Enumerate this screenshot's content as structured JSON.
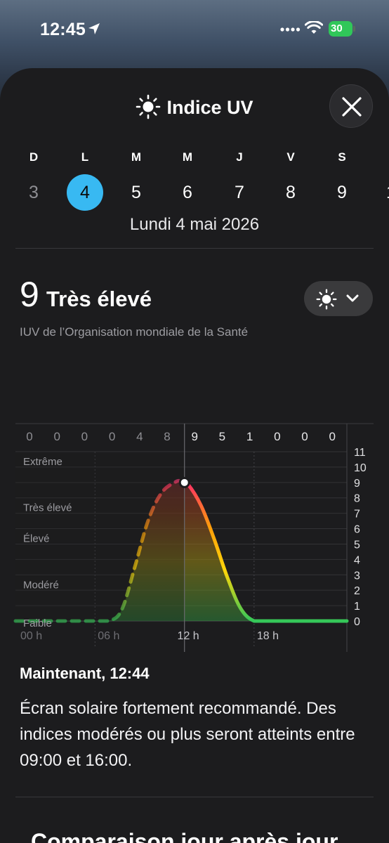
{
  "status_bar": {
    "time": "12:45",
    "battery": "30",
    "battery_color": "#30c759"
  },
  "header": {
    "title": "Indice UV",
    "icon": "sun-icon",
    "close_icon": "close-icon"
  },
  "week": {
    "letters": [
      "D",
      "L",
      "M",
      "M",
      "J",
      "V",
      "S"
    ],
    "days": [
      {
        "num": "3",
        "state": "past"
      },
      {
        "num": "4",
        "state": "selected"
      },
      {
        "num": "5",
        "state": "normal"
      },
      {
        "num": "6",
        "state": "normal"
      },
      {
        "num": "7",
        "state": "normal"
      },
      {
        "num": "8",
        "state": "normal"
      },
      {
        "num": "9",
        "state": "normal"
      },
      {
        "num": "1",
        "state": "normal"
      }
    ],
    "selected_date_label": "Lundi 4 mai 2026",
    "accent": "#38b9f2"
  },
  "summary": {
    "value": "9",
    "level": "Très élevé",
    "source": "IUV de l’Organisation mondiale de la Santé",
    "mode_icon": "sun-icon",
    "mode_chevron": "chevron-down-icon"
  },
  "chart_data": {
    "type": "area",
    "hourly_top_labels": [
      "0",
      "0",
      "0",
      "0",
      "4",
      "8",
      "9",
      "5",
      "1",
      "0",
      "0",
      "0"
    ],
    "x_tick_labels": [
      "00 h",
      "06 h",
      "12 h",
      "18 h"
    ],
    "y_ticks": [
      "0",
      "1",
      "2",
      "3",
      "4",
      "5",
      "6",
      "7",
      "8",
      "9",
      "10",
      "11"
    ],
    "ylim": [
      0,
      11
    ],
    "xlim": [
      0,
      25
    ],
    "category_labels": [
      {
        "text": "Extrême",
        "value": 11
      },
      {
        "text": "Très élevé",
        "value": 8
      },
      {
        "text": "Élevé",
        "value": 6
      },
      {
        "text": "Modéré",
        "value": 3
      },
      {
        "text": "Faible",
        "value": 0.5
      }
    ],
    "current_hour": 12.75,
    "current_value": 9,
    "x": [
      0,
      1,
      2,
      3,
      4,
      5,
      6,
      7,
      8,
      9,
      10,
      11,
      12,
      12.5,
      13,
      14,
      15,
      16,
      17,
      18,
      19,
      20,
      21,
      22,
      23,
      24,
      25
    ],
    "y": [
      0,
      0,
      0,
      0,
      0,
      0,
      0,
      0,
      0.7,
      3.5,
      6.5,
      8.3,
      9,
      9.1,
      8.9,
      7.5,
      5.3,
      2.8,
      0.8,
      0,
      0,
      0,
      0,
      0,
      0,
      0,
      0
    ],
    "grid": true,
    "colors": {
      "low": "#34c759",
      "moderate": "#ffd60a",
      "high": "#ff9f0a",
      "very_high": "#ff375f",
      "extreme": "#bf5af2"
    }
  },
  "now": {
    "title": "Maintenant, 12:44",
    "text": "Écran solaire fortement recommandé. Des indices modérés ou plus seront atteints entre 09:00 et 16:00."
  },
  "comparison": {
    "title": "Comparaison jour après jour"
  }
}
